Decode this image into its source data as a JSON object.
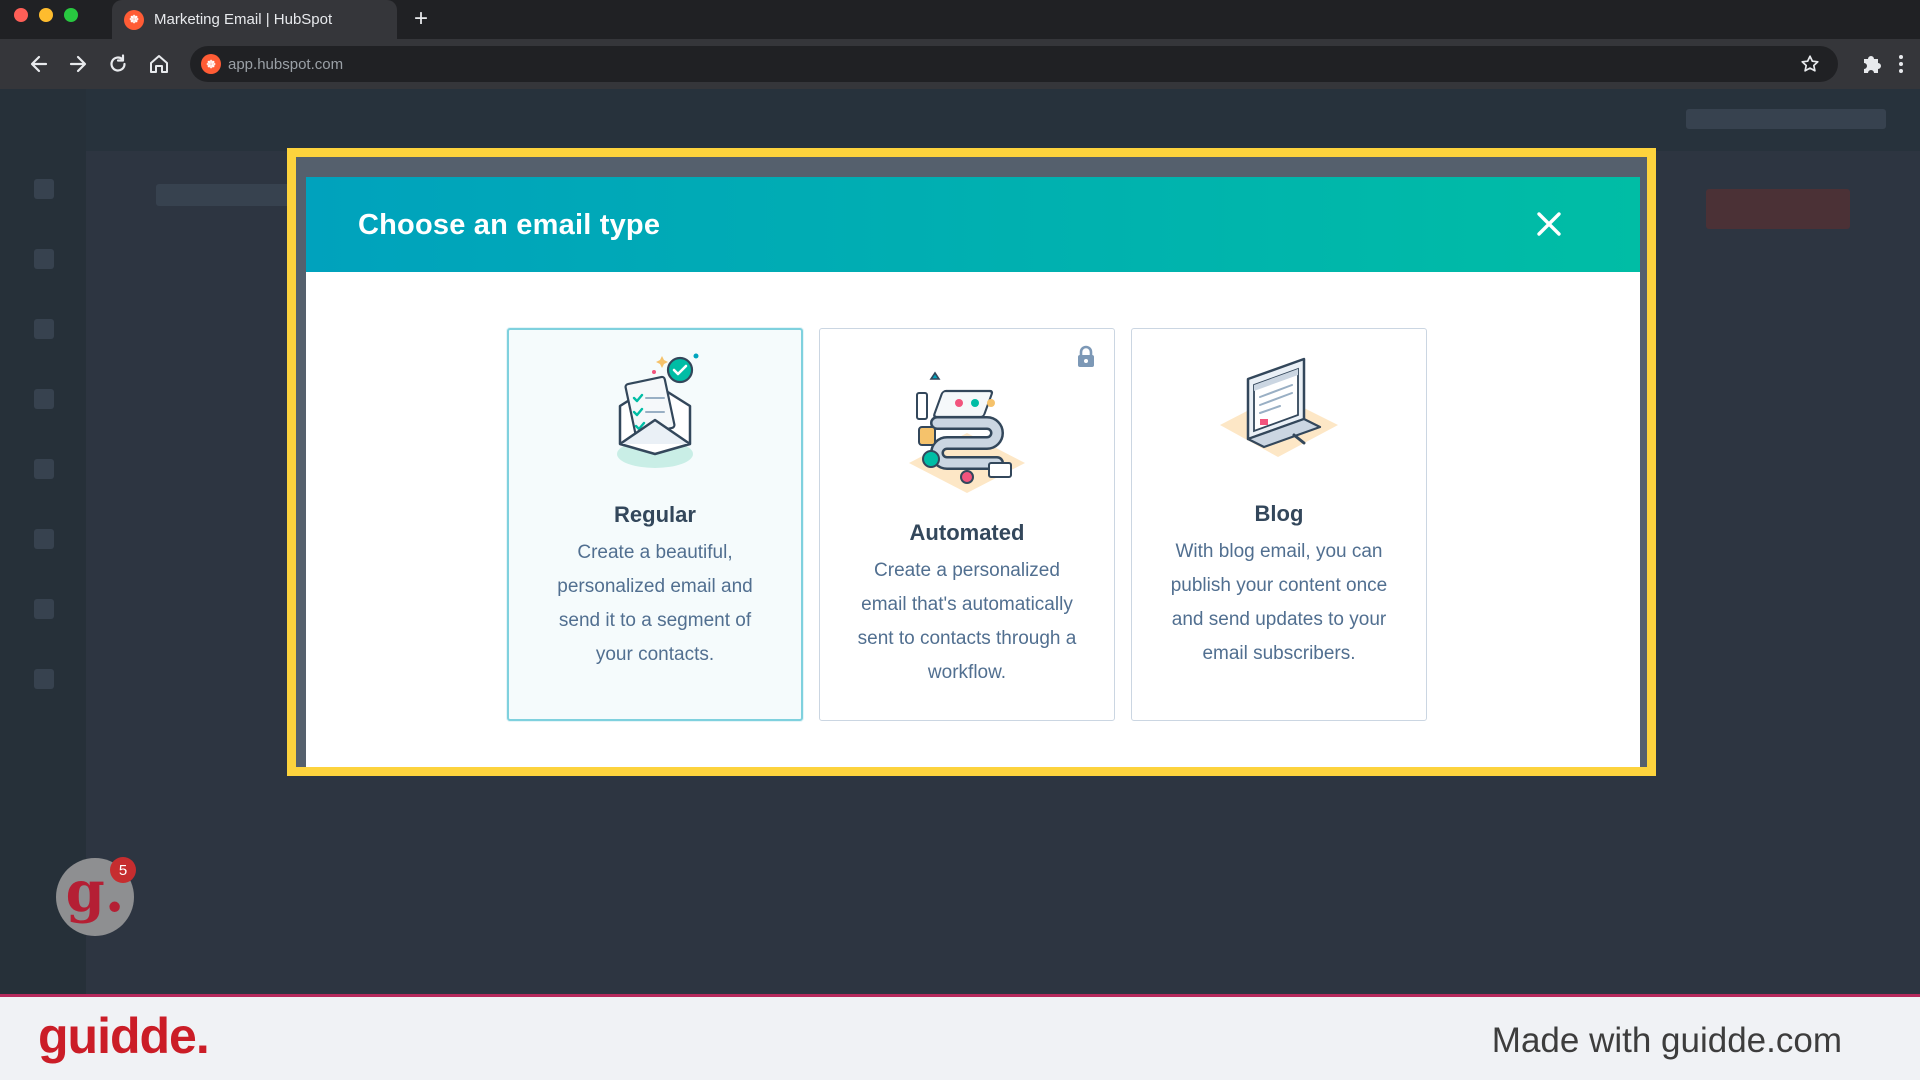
{
  "browser": {
    "tab_title": "Marketing Email | HubSpot",
    "favicon_glyph": "☸",
    "new_tab_glyph": "+",
    "url": "app.hubspot.com",
    "icons": [
      "back-arrow-icon",
      "forward-arrow-icon",
      "reload-icon",
      "home-icon",
      "bookmark-star-icon",
      "extensions-puzzle-icon",
      "more-menu-icon"
    ]
  },
  "modal": {
    "title": "Choose an email type",
    "close_icon": "close-icon",
    "cards": [
      {
        "title": "Regular",
        "description": "Create a beautiful, personalized email and send it to a segment of your contacts.",
        "selected": true,
        "icon": "envelope-checklist-illustration"
      },
      {
        "title": "Automated",
        "description": "Create a personalized email that's automatically sent to contacts through a workflow.",
        "locked": true,
        "icon": "workflow-machine-illustration"
      },
      {
        "title": "Blog",
        "description": "With blog email, you can publish your content once and send updates to your email subscribers.",
        "icon": "blog-laptop-illustration"
      }
    ]
  },
  "overlay": {
    "badge_letter": "g.",
    "badge_count": "5"
  },
  "footer": {
    "logo": "guidde.",
    "made_with": "Made with guidde.com"
  },
  "colors": {
    "header_gradient_start": "#00a2bd",
    "header_gradient_end": "#00bda5",
    "highlight_border": "#fdd33d",
    "guidde_red": "#cb1d27"
  }
}
